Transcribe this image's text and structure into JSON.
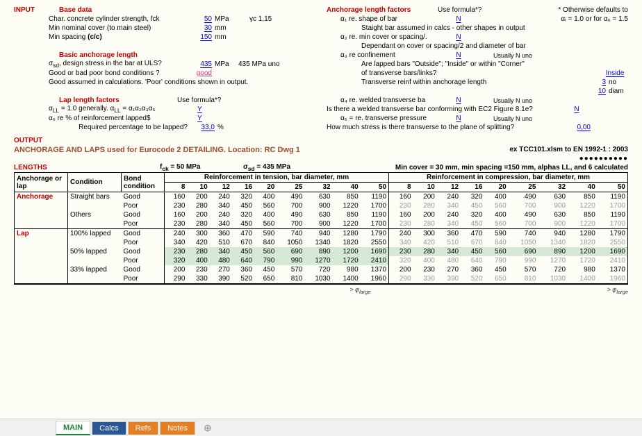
{
  "headings": {
    "input": "INPUT",
    "base_data": "Base data",
    "anchorage_factors": "Anchorage length factors",
    "use_formula": "Use formula*?",
    "otherwise_defaults": "* Otherwise defaults to",
    "basic_anchorage": "Basic anchorage length",
    "lap_factors": "Lap length factors",
    "output": "OUTPUT",
    "output_title": "ANCHORAGE AND LAPS used for Eurocode 2 DETAILING. Location: RC Dwg 1",
    "ex_ref": "ex TCC101.xlsm to EN 1992-1 : 2003",
    "lengths": "LENGTHS",
    "fck_txt": "f",
    "fck_sub": "ck",
    "fck_val": " = 50 MPa",
    "sigma_txt": "σ",
    "sigma_sub": "sd",
    "sigma_val": " = 435 MPa",
    "summary_right": "Min cover = 30 mm, min spacing =150 mm, alphas LL, and 6  calculated",
    "phi_large": "> φ",
    "phi_large_sub": "large"
  },
  "base_data": {
    "fck_label": "Char. concrete cylinder strength, fck",
    "fck_val": "50",
    "fck_unit": "MPa",
    "gamma": "γc  1,15",
    "cover_label": "Min nominal cover (to main steel)",
    "cover_val": "30",
    "cover_unit": "mm",
    "spacing_label": "Min spacing (c/c)",
    "spacing_label_bold": "",
    "spacing_val": "150",
    "spacing_unit": "mm"
  },
  "basic_anch": {
    "sigma_label": "σ",
    "sigma_sub": "sd",
    "sigma_rest": ", design stress in the bar at ULS?",
    "sigma_val": "435",
    "sigma_unit": "MPa",
    "sigma_note": "435 MPa uno",
    "bond_label": "Good or bad poor bond conditions ?",
    "bond_val": "good",
    "bond_note": "Good assumed in calculations. 'Poor' conditions shown in output."
  },
  "lap": {
    "a_label_a": "α",
    "a_sub": "LL",
    "a_rest": " = 1.0 generally.  α",
    "a_eq": " = α₁α₂α₃α₅",
    "a_val": "Y",
    "a6_label": "α₆ re % of reinforcement lapped$",
    "a6_val": "Y",
    "pct_label": "Required percentage to be lapped?",
    "pct_val": "33,0",
    "pct_unit": "%"
  },
  "anch_factors": {
    "a1_label": "α₁ re. shape of bar",
    "a1_val": "N",
    "a1_note": "αᵢ = 1.0 or for α₆ = 1.5",
    "straight_note": "Staight bar assumed in calcs - other shapes in output",
    "a2_label": "α₂ re. min cover or spacing/.",
    "a2_val": "N",
    "a2_note": "Dependant on cover or spacing/2 and diameter of bar",
    "a3_label": "α₃ re confinement",
    "a3_val": "N",
    "a3_usual": "Usually N uno",
    "lapped_q": "Are lapped bars  \"Outside\"; \"Inside\" or within  \"Corner\"",
    "lapped_q2": " of transverse bars/links?",
    "lapped_val": "Inside",
    "trans_label": "Transverse reinf within anchorage length",
    "trans_n": "3",
    "trans_n_unit": "no",
    "trans_d": "10",
    "trans_d_unit": "diam",
    "a4_label": "α₄ re. welded transverse ba",
    "a4_val": "N",
    "a4_usual": "Usually N uno",
    "welded_q": "Is there a welded transverse bar conforming with EC2 Figure 8.1e?",
    "welded_val": "N",
    "a5_label": "α₅ = re. transverse pressure",
    "a5_val": "N",
    "a5_usual": "Usually N uno",
    "stress_q": "How much stress is there  transverse to the plane of splitting?",
    "stress_val": "0,00"
  },
  "table": {
    "col_anchor": "Anchorage or lap",
    "col_cond": "Condition",
    "col_bond": "Bond condition",
    "hdr_tension": "Reinforcement in tension, bar diameter, mm",
    "hdr_comp": "Reinforcement in compression, bar diameter, mm",
    "diams": [
      "8",
      "10",
      "12",
      "16",
      "20",
      "25",
      "32",
      "40",
      "50"
    ],
    "rows": [
      {
        "group": "Anchorage",
        "cond": "Straight bars",
        "bond": "Good",
        "t": [
          160,
          200,
          240,
          320,
          400,
          490,
          630,
          850,
          1190
        ],
        "c": [
          160,
          200,
          240,
          320,
          400,
          490,
          630,
          850,
          1190
        ]
      },
      {
        "group": "",
        "cond": "",
        "bond": "Poor",
        "t": [
          230,
          280,
          340,
          450,
          560,
          700,
          900,
          1220,
          1700
        ],
        "c": [
          230,
          280,
          340,
          450,
          560,
          700,
          900,
          1220,
          1700
        ],
        "cgrey": true
      },
      {
        "group": "",
        "cond": "Others",
        "bond": "Good",
        "t": [
          160,
          200,
          240,
          320,
          400,
          490,
          630,
          850,
          1190
        ],
        "c": [
          160,
          200,
          240,
          320,
          400,
          490,
          630,
          850,
          1190
        ],
        "sep": true
      },
      {
        "group": "",
        "cond": "",
        "bond": "Poor",
        "t": [
          230,
          280,
          340,
          450,
          560,
          700,
          900,
          1220,
          1700
        ],
        "c": [
          230,
          280,
          340,
          450,
          560,
          700,
          900,
          1220,
          1700
        ],
        "cgrey": true
      },
      {
        "group": "Lap",
        "cond": "100% lapped",
        "bond": "Good",
        "t": [
          240,
          300,
          360,
          470,
          590,
          740,
          940,
          1280,
          1790
        ],
        "c": [
          240,
          300,
          360,
          470,
          590,
          740,
          940,
          1280,
          1790
        ],
        "top": true
      },
      {
        "group": "",
        "cond": "",
        "bond": "Poor",
        "t": [
          340,
          420,
          510,
          670,
          840,
          1050,
          1340,
          1820,
          2550
        ],
        "c": [
          340,
          420,
          510,
          670,
          840,
          1050,
          1340,
          1820,
          2550
        ],
        "cgrey": true
      },
      {
        "group": "",
        "cond": "50% lapped",
        "bond": "Good",
        "t": [
          230,
          280,
          340,
          450,
          560,
          690,
          890,
          1200,
          1690
        ],
        "c": [
          230,
          280,
          340,
          450,
          560,
          690,
          890,
          1200,
          1690
        ],
        "green": true
      },
      {
        "group": "",
        "cond": "",
        "bond": "Poor",
        "t": [
          320,
          400,
          480,
          640,
          790,
          990,
          1270,
          1720,
          2410
        ],
        "c": [
          320,
          400,
          480,
          640,
          790,
          990,
          1270,
          1720,
          2410
        ],
        "cgrey": true,
        "greenpoor": true
      },
      {
        "group": "",
        "cond": "33% lapped",
        "bond": "Good",
        "t": [
          200,
          230,
          270,
          360,
          450,
          570,
          720,
          980,
          1370
        ],
        "c": [
          200,
          230,
          270,
          360,
          450,
          570,
          720,
          980,
          1370
        ]
      },
      {
        "group": "",
        "cond": "",
        "bond": "Poor",
        "t": [
          290,
          330,
          390,
          520,
          650,
          810,
          1030,
          1400,
          1960
        ],
        "c": [
          290,
          330,
          390,
          520,
          650,
          810,
          1030,
          1400,
          1960
        ],
        "cgrey": true
      }
    ]
  },
  "tabs": {
    "main": "MAIN",
    "calcs": "Calcs",
    "refs": "Refs",
    "notes": "Notes"
  }
}
